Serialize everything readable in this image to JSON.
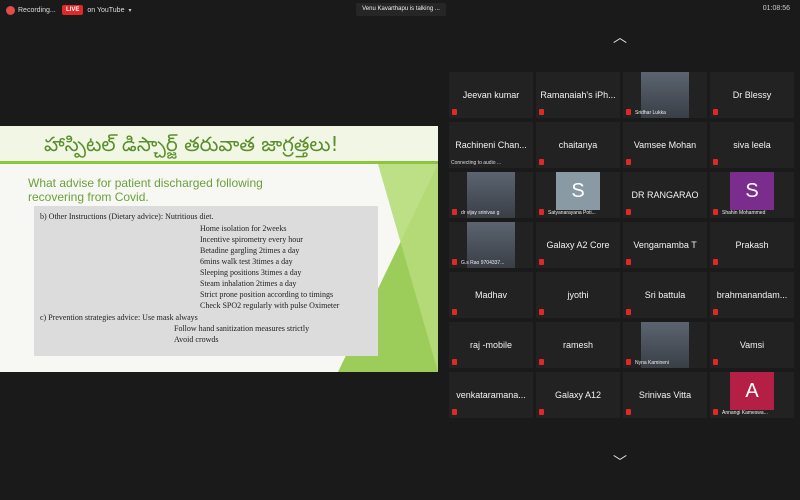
{
  "topbar": {
    "recording": "Recording...",
    "live_badge": "LIVE",
    "live_platform": "on YouTube",
    "talking": "Venu Kavarthapu is talking ...",
    "clock": "01:08:56"
  },
  "slide": {
    "title": "హాస్పిటల్ డిస్చార్జ్ తరువాత జాగ్రత్తలు!",
    "heading_line1": "What advise for patient discharged following",
    "heading_line2": "recovering from Covid.",
    "scan_lines": [
      "b)    Other Instructions (Dietary advice):  Nutritious diet.",
      "Home isolation for 2weeks",
      "Incentive spirometry every hour",
      "Betadine gargling 2times a day",
      "6mins walk test 3times a day",
      "Sleeping positions 3times a day",
      "Steam inhalation 2times a day",
      "Strict prone position according to timings",
      "Check SPO2 regularly with pulse Oximeter",
      "c)    Prevention strategies advice:  Use mask always",
      "Follow hand sanitization measures strictly",
      "Avoid crowds"
    ]
  },
  "participants": [
    {
      "name": "Jeevan kumar"
    },
    {
      "name": "Ramanaiah's iPh..."
    },
    {
      "name": "Sridhar Lukka",
      "video": true
    },
    {
      "name": "Dr Blessy"
    },
    {
      "name": "Rachineni Chan...",
      "status": "Connecting to audio ..."
    },
    {
      "name": "chaitanya"
    },
    {
      "name": "Vamsee Mohan"
    },
    {
      "name": "siva leela"
    },
    {
      "name": "dr vijay srinivas g",
      "video": true
    },
    {
      "name": "Satyanarayana Poti...",
      "avatar": "S",
      "avatar_color": "#8a9aa5"
    },
    {
      "name": "DR RANGARAO"
    },
    {
      "name": "Shahin Mohammed",
      "avatar": "S",
      "avatar_color": "#7b2d8e"
    },
    {
      "name": "G.s Rao 9704337...",
      "video": true
    },
    {
      "name": "Galaxy A2 Core"
    },
    {
      "name": "Vengamamba T"
    },
    {
      "name": "Prakash"
    },
    {
      "name": "Madhav"
    },
    {
      "name": "jyothi"
    },
    {
      "name": "Sri battula"
    },
    {
      "name": "brahmanandam..."
    },
    {
      "name": "raj -mobile"
    },
    {
      "name": "ramesh"
    },
    {
      "name": "Nyna Kamineni",
      "video": true
    },
    {
      "name": "Vamsi"
    },
    {
      "name": "venkataramana..."
    },
    {
      "name": "Galaxy A12"
    },
    {
      "name": "Srinivas Vitta"
    },
    {
      "name": "Annangi Kameswa...",
      "avatar": "A",
      "avatar_color": "#b51f45"
    }
  ],
  "icons": {
    "nav_up": "chevron-up-icon",
    "nav_down": "chevron-down-icon",
    "mic": "muted-mic-icon"
  }
}
